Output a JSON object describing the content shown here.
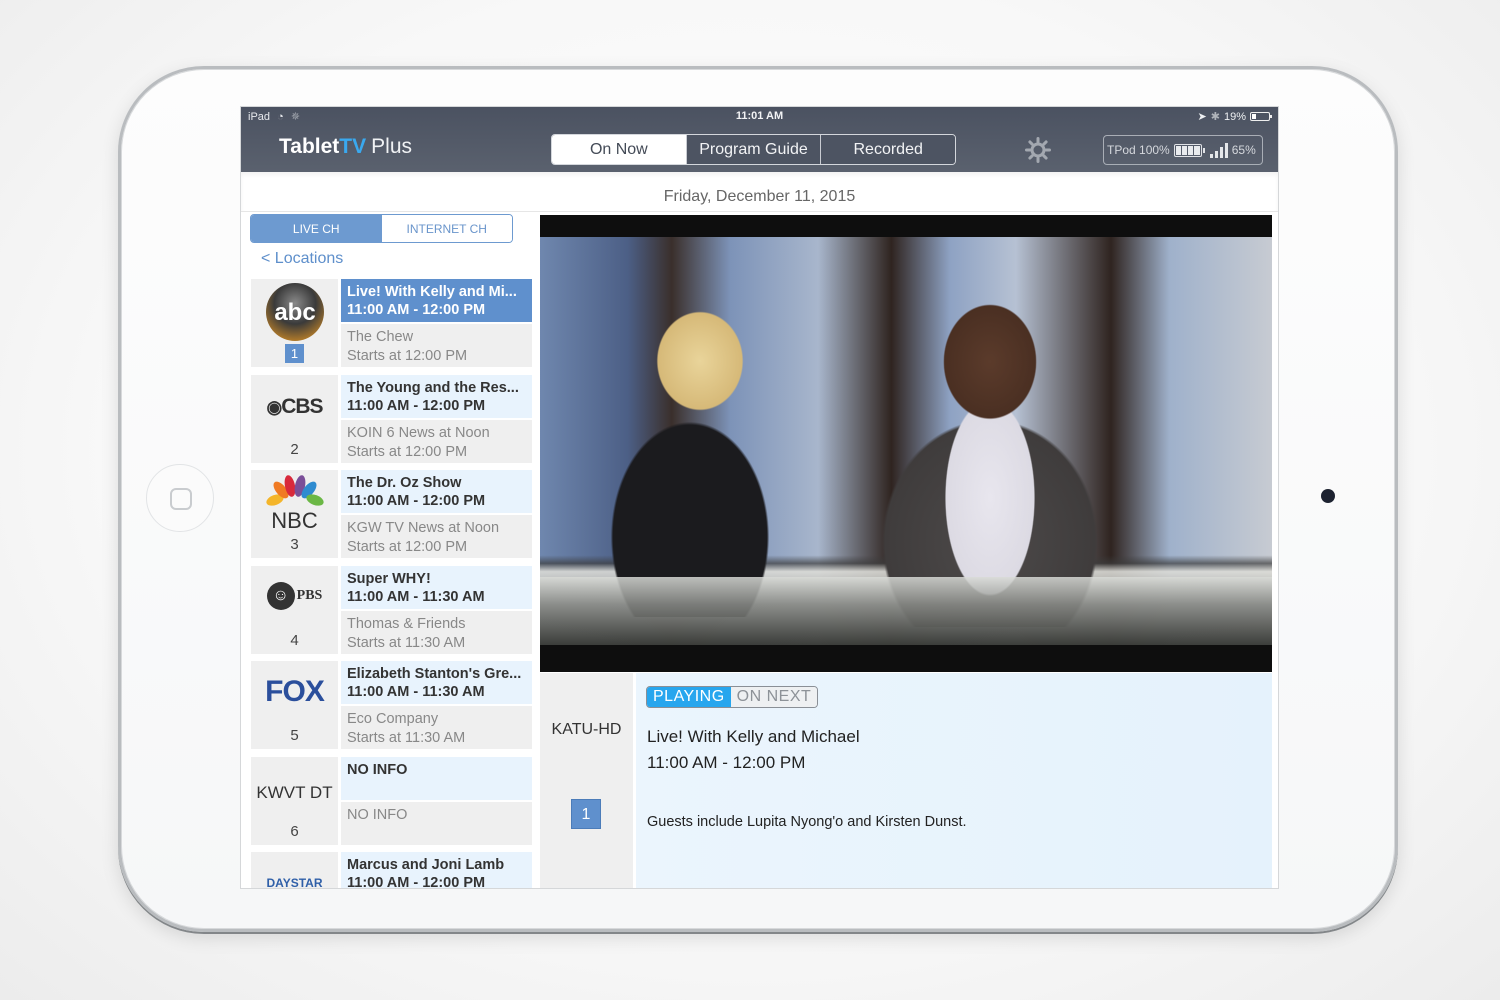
{
  "status_bar": {
    "device": "iPad",
    "time": "11:01 AM",
    "battery": "19%"
  },
  "app": {
    "brand_part1": "Tablet",
    "brand_part2": "TV",
    "brand_part3": "Plus",
    "accent_color": "#3aa9ef"
  },
  "nav_tabs": [
    {
      "label": "On Now",
      "active": true
    },
    {
      "label": "Program Guide",
      "active": false
    },
    {
      "label": "Recorded",
      "active": false
    }
  ],
  "tpod": {
    "label": "TPod 100%",
    "signal": "65%"
  },
  "date": "Friday, December 11, 2015",
  "channel_toggle": [
    {
      "label": "LIVE CH",
      "active": true
    },
    {
      "label": "INTERNET CH",
      "active": false
    }
  ],
  "locations_link": "< Locations",
  "channels": [
    {
      "logo": "abc",
      "number": "1",
      "now_title": "Live! With Kelly and Mi...",
      "now_time": "11:00 AM - 12:00 PM",
      "next_title": "The Chew",
      "next_time": "Starts at 12:00 PM",
      "selected": true
    },
    {
      "logo": "CBS",
      "number": "2",
      "now_title": "The Young and the Res...",
      "now_time": "11:00 AM - 12:00 PM",
      "next_title": "KOIN 6 News at Noon",
      "next_time": "Starts at 12:00 PM"
    },
    {
      "logo": "NBC",
      "number": "3",
      "now_title": "The Dr. Oz Show",
      "now_time": "11:00 AM - 12:00 PM",
      "next_title": "KGW TV News at Noon",
      "next_time": "Starts at 12:00 PM"
    },
    {
      "logo": "PBS",
      "number": "4",
      "now_title": "Super WHY!",
      "now_time": "11:00 AM - 11:30 AM",
      "next_title": "Thomas & Friends",
      "next_time": "Starts at 11:30 AM"
    },
    {
      "logo": "FOX",
      "number": "5",
      "now_title": "Elizabeth Stanton's Gre...",
      "now_time": "11:00 AM - 11:30 AM",
      "next_title": "Eco Company",
      "next_time": "Starts at 11:30 AM"
    },
    {
      "logo": "KWVT DT",
      "number": "6",
      "now_title": "NO INFO",
      "now_time": "",
      "next_title": "NO INFO",
      "next_time": ""
    },
    {
      "logo": "DAYSTAR",
      "number": "",
      "now_title": "Marcus and Joni Lamb",
      "now_time": "11:00 AM - 12:00 PM",
      "next_title": "",
      "next_time": ""
    }
  ],
  "now_playing": {
    "channel_name": "KATU-HD",
    "channel_number": "1",
    "tab_playing": "PLAYING",
    "tab_on_next": "ON NEXT",
    "title": "Live! With Kelly and Michael",
    "time": "11:00 AM - 12:00 PM",
    "description": "Guests include Lupita Nyong'o and Kirsten Dunst."
  }
}
